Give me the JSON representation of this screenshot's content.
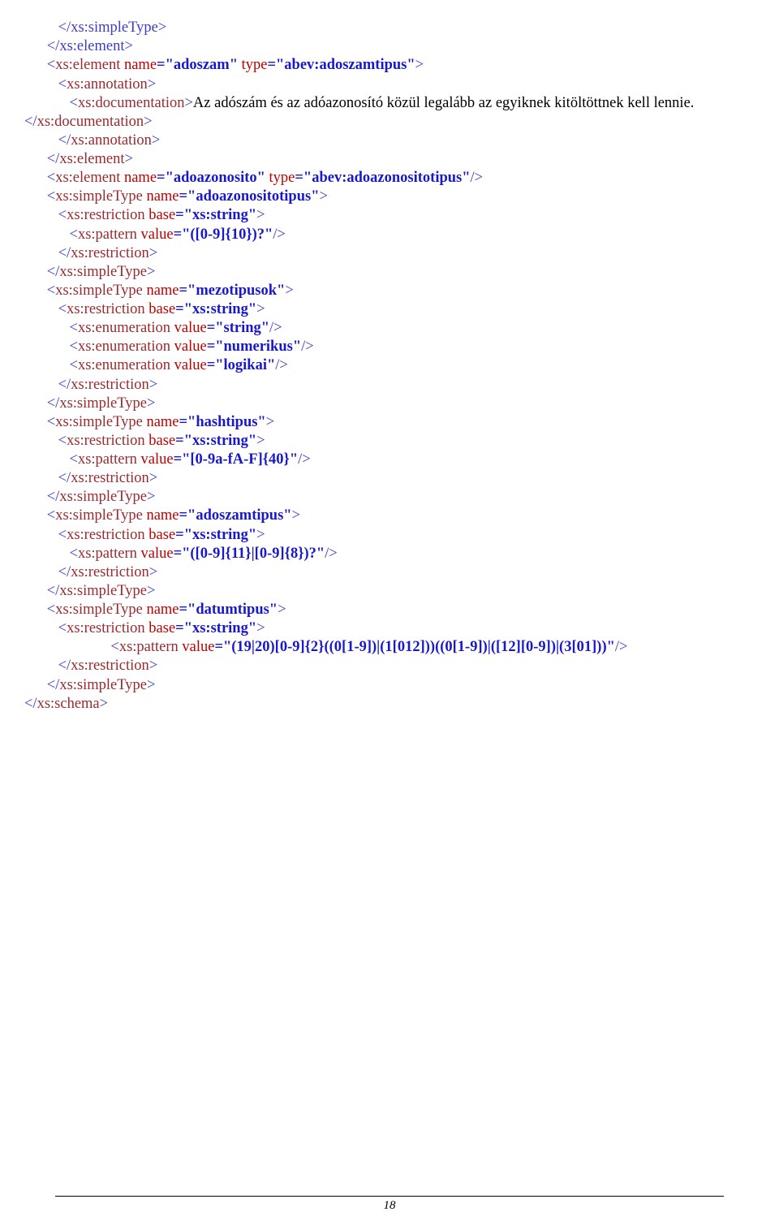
{
  "lines": {
    "l0": "         </xs:simpleType>",
    "l1": "      </xs:element>",
    "l2a": "      <xs:element",
    "l2name": " name",
    "l2val1": "=\"adoszam\"",
    "l2type": " type",
    "l2val2": "=\"abev:adoszamtipus\"",
    "l2end": ">",
    "l3": "         <xs:annotation>",
    "l4a": "            <xs:documentation>",
    "l4doc": "Az adószám és az adóazonosító közül legalább az egyiknek kitöltöttnek kell lennie.",
    "l4b": "</xs:documentation>",
    "l5": "         </xs:annotation>",
    "l6": "      </xs:element>",
    "l7a": "      <xs:element",
    "l7name": " name",
    "l7val1": "=\"adoazonosito\"",
    "l7type": " type",
    "l7val2": "=\"abev:adoazonositotipus\"",
    "l7end": "/>",
    "l8a": "      <xs:simpleType",
    "l8name": " name",
    "l8val1": "=\"adoazonositotipus\"",
    "l8end": ">",
    "l9a": "         <xs:restriction",
    "l9base": " base",
    "l9val1": "=\"xs:string\"",
    "l9end": ">",
    "l10a": "            <xs:pattern",
    "l10name": " value",
    "l10val1": "=\"([0-9]{10})?\"",
    "l10end": "/>",
    "l11": "         </xs:restriction>",
    "l12": "      </xs:simpleType>",
    "l13a": "      <xs:simpleType",
    "l13name": " name",
    "l13val1": "=\"mezotipusok\"",
    "l13end": ">",
    "l14a": "         <xs:restriction",
    "l14base": " base",
    "l14val1": "=\"xs:string\"",
    "l14end": ">",
    "l15a": "            <xs:enumeration",
    "l15name": " value",
    "l15val1": "=\"string\"",
    "l15end": "/>",
    "l16a": "            <xs:enumeration",
    "l16name": " value",
    "l16val1": "=\"numerikus\"",
    "l16end": "/>",
    "l17a": "            <xs:enumeration",
    "l17name": " value",
    "l17val1": "=\"logikai\"",
    "l17end": "/>",
    "l18": "         </xs:restriction>",
    "l19": "      </xs:simpleType>",
    "l20a": "      <xs:simpleType",
    "l20name": " name",
    "l20val1": "=\"hashtipus\"",
    "l20end": ">",
    "l21a": "         <xs:restriction",
    "l21base": " base",
    "l21val1": "=\"xs:string\"",
    "l21end": ">",
    "l22a": "            <xs:pattern",
    "l22name": " value",
    "l22val1": "=\"[0-9a-fA-F]{40}\"",
    "l22end": "/>",
    "l23": "         </xs:restriction>",
    "l24": "      </xs:simpleType>",
    "l25a": "      <xs:simpleType",
    "l25name": " name",
    "l25val1": "=\"adoszamtipus\"",
    "l25end": ">",
    "l26a": "         <xs:restriction",
    "l26base": " base",
    "l26val1": "=\"xs:string\"",
    "l26end": ">",
    "l27a": "            <xs:pattern",
    "l27name": " value",
    "l27val1": "=\"([0-9]{11}|[0-9]{8})?\"",
    "l27end": "/>",
    "l28": "         </xs:restriction>",
    "l29": "      </xs:simpleType>",
    "l30a": "      <xs:simpleType",
    "l30name": " name",
    "l30val1": "=\"datumtipus\"",
    "l30end": ">",
    "l31a": "         <xs:restriction",
    "l31base": " base",
    "l31val1": "=\"xs:string\"",
    "l31end": ">",
    "l32a": "                       <xs:pattern",
    "l32name": " value",
    "l32val1": "=\"(19|20)[0-9]{2}((0[1-9])|(1[012]))((0[1-9])|([12][0-9])|(3[01]))\"",
    "l32end": "/>",
    "l33": "         </xs:restriction>",
    "l34": "      </xs:simpleType>",
    "l35": "</xs:schema>"
  },
  "pageNumber": "18"
}
